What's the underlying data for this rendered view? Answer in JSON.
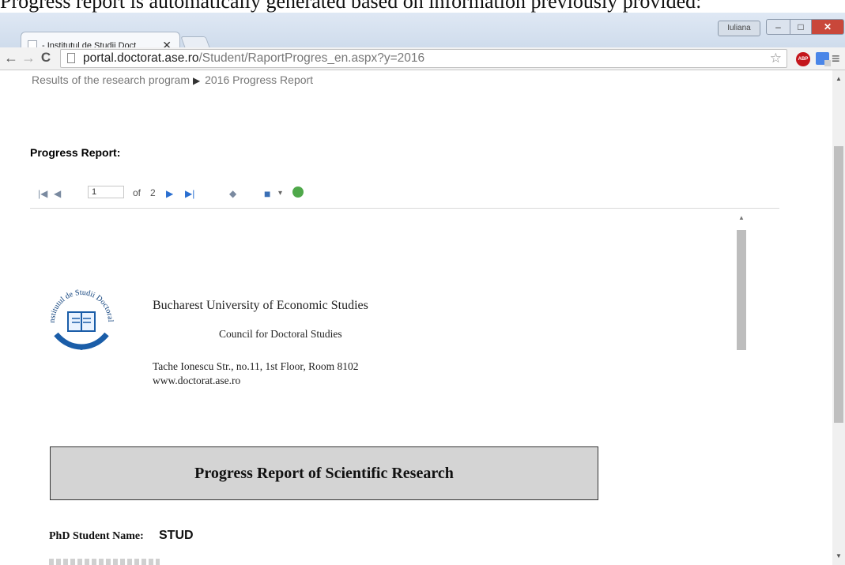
{
  "caption": "Progress report is automatically generated based on information previously provided:",
  "browser": {
    "tab_title": "- Institutul de Studii Doct",
    "user_badge": "Iuliana",
    "url_host": "portal.doctorat.ase.ro",
    "url_path": "/Student/RaportProgres_en.aspx?y=2016",
    "icons": {
      "back": "back-arrow-icon",
      "forward": "forward-arrow-icon",
      "reload": "reload-icon",
      "star": "bookmark-star-icon",
      "menu": "menu-icon"
    }
  },
  "page": {
    "breadcrumb_parent": "Results of the research program",
    "breadcrumb_current": "2016 Progress Report",
    "heading": "Progress Report:",
    "viewer": {
      "page_number": "1",
      "of_label": "of",
      "page_count": "2"
    },
    "report": {
      "logo_text": "Institutul de Studii Doctorale",
      "university": "Bucharest University of Economic Studies",
      "council": "Council for Doctoral Studies",
      "address": "Tache Ionescu Str., no.11, 1st Floor, Room 8102",
      "website": "www.doctorat.ase.ro",
      "title": "Progress Report of Scientific Research",
      "student_name_label": "PhD Student Name:",
      "student_name_value": "STUD"
    }
  }
}
